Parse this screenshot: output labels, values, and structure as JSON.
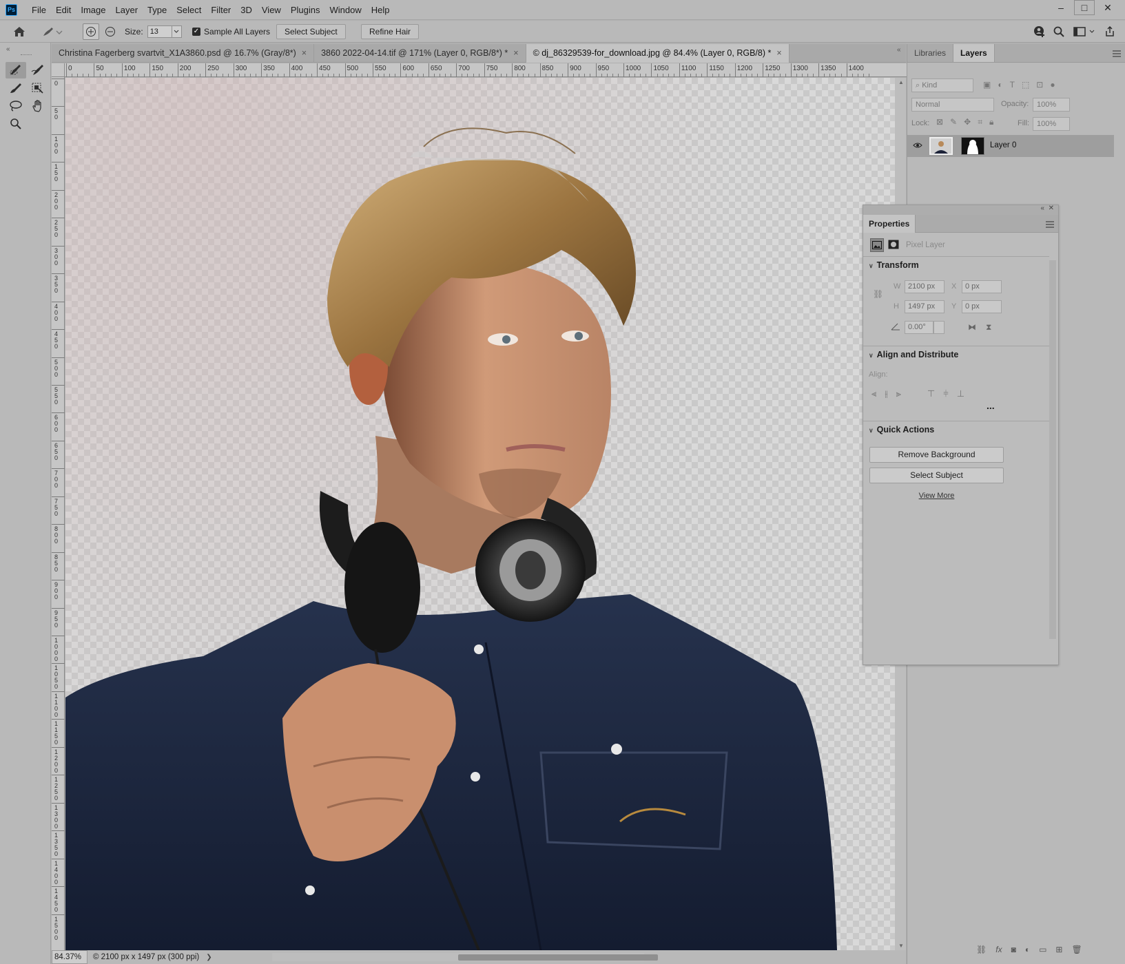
{
  "app": {
    "logo": "Ps"
  },
  "menu": [
    "File",
    "Edit",
    "Image",
    "Layer",
    "Type",
    "Select",
    "Filter",
    "3D",
    "View",
    "Plugins",
    "Window",
    "Help"
  ],
  "window_controls": {
    "minimize": "–",
    "maximize": "□",
    "close": "✕"
  },
  "options": {
    "size_label": "Size:",
    "size_value": "13",
    "sample_all_layers_label": "Sample All Layers",
    "sample_all_layers_checked": true,
    "select_subject_label": "Select Subject",
    "refine_hair_label": "Refine Hair"
  },
  "tabs": [
    {
      "label": "Christina Fagerberg svartvit_X1A3860.psd @ 16.7% (Gray/8*)",
      "active": false
    },
    {
      "label": "3860 2022-04-14.tif @ 171% (Layer 0, RGB/8*) *",
      "active": false
    },
    {
      "label": "© dj_86329539-for_download.jpg @ 84.4% (Layer 0, RGB/8) *",
      "active": true
    }
  ],
  "tab_close": "×",
  "ruler_top": [
    "0",
    "50",
    "100",
    "150",
    "200",
    "250",
    "300",
    "350",
    "400",
    "450",
    "500",
    "550",
    "600",
    "650",
    "700",
    "750",
    "800",
    "850",
    "900",
    "950",
    "1000",
    "1050",
    "1100",
    "1150",
    "1200",
    "1250",
    "1300",
    "1350",
    "1400"
  ],
  "ruler_left": [
    "0",
    "50",
    "100",
    "150",
    "200",
    "250",
    "300",
    "350",
    "400",
    "450",
    "500",
    "550",
    "600",
    "650",
    "700",
    "750",
    "800",
    "850",
    "900",
    "950",
    "1000",
    "1050",
    "1100",
    "1150",
    "1200",
    "1250",
    "1300",
    "1350",
    "1400",
    "1450",
    "1500"
  ],
  "status": {
    "zoom": "84.37%",
    "doc_info": "© 2100 px x 1497 px (300 ppi)",
    "arrow": "❯"
  },
  "right_panel": {
    "tabs": [
      {
        "label": "Libraries",
        "active": false
      },
      {
        "label": "Layers",
        "active": true
      }
    ],
    "filter_kind": "Kind",
    "blend_mode": "Normal",
    "opacity_label": "Opacity:",
    "opacity_value": "100%",
    "lock_label": "Lock:",
    "fill_label": "Fill:",
    "fill_value": "100%",
    "layer_name": "Layer 0"
  },
  "properties": {
    "tab": "Properties",
    "kind": "Pixel Layer",
    "transform_title": "Transform",
    "w_label": "W",
    "w_value": "2100 px",
    "h_label": "H",
    "h_value": "1497 px",
    "x_label": "X",
    "x_value": "0 px",
    "y_label": "Y",
    "y_value": "0 px",
    "angle_value": "0.00°",
    "align_title": "Align and Distribute",
    "align_label": "Align:",
    "more": "...",
    "quick_actions_title": "Quick Actions",
    "remove_bg": "Remove Background",
    "select_subject": "Select Subject",
    "view_more": "View More"
  },
  "colors": {
    "ui_gray": "#b9b9b9",
    "shirt_denim": "#1c2740",
    "hair": "#a57c44",
    "skin": "#c9916e"
  }
}
